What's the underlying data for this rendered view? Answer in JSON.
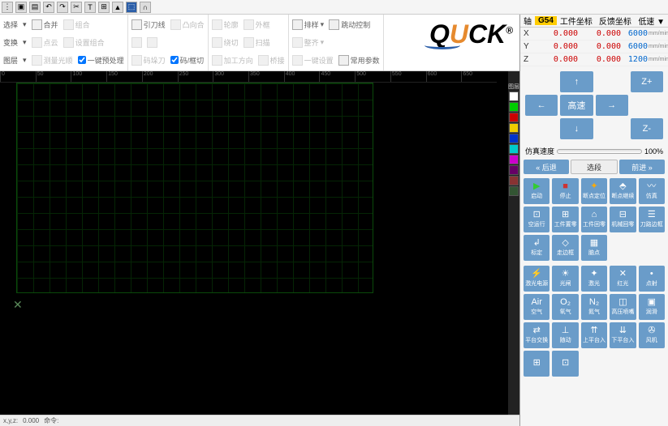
{
  "topbar": {
    "label": "⋮"
  },
  "ribbon": {
    "g1_label": "选择",
    "g1_items": [
      [
        "合并",
        "组合"
      ],
      [
        "点云",
        "设置组合"
      ],
      [
        "测量光顺",
        "一键预处理"
      ]
    ],
    "g1_row3_label": "变换",
    "g1_row4_label": "图层",
    "g2_items": [
      [
        "引刀线",
        "凸向合"
      ],
      [
        " ",
        " "
      ],
      [
        "码垛刀",
        "码/框切"
      ]
    ],
    "g3_items": [
      [
        "轮廓",
        "外框"
      ],
      [
        "绕切",
        "扫描"
      ],
      [
        "加工方向",
        "桥接"
      ]
    ],
    "g4_items": [
      [
        "排样",
        "跳动控制"
      ],
      [
        "整齐",
        " "
      ],
      [
        "一键设置",
        "常用参数"
      ]
    ]
  },
  "logo": {
    "text_q": "Q",
    "text_u": "U",
    "text_ck": "CK",
    "reg": "®"
  },
  "ruler_ticks": [
    "0",
    "50",
    "100",
    "150",
    "200",
    "250",
    "300",
    "350",
    "400",
    "450",
    "500",
    "550",
    "600",
    "650"
  ],
  "layer_colors": [
    "#ffffff",
    "#00cc00",
    "#cc0000",
    "#eecc00",
    "#0033cc",
    "#00cccc",
    "#cc00cc",
    "#660066",
    "#883333",
    "#335533"
  ],
  "layer_top_label": "图层",
  "statusbar": [
    "x,y,z:",
    "0.000",
    "命令:"
  ],
  "rpanel": {
    "head": {
      "axis_label": "轴",
      "g54": "G54",
      "wcs": "工件坐标",
      "mcs": "反馈坐标",
      "speed": "低速 ▼"
    },
    "rows": [
      {
        "axis": "X",
        "v1": "0.000",
        "v2": "0.000",
        "spd": "6000",
        "unit": "mm/min"
      },
      {
        "axis": "Y",
        "v1": "0.000",
        "v2": "0.000",
        "spd": "6000",
        "unit": "mm/min"
      },
      {
        "axis": "Z",
        "v1": "0.000",
        "v2": "0.000",
        "spd": "1200",
        "unit": "mm/min"
      }
    ],
    "jog": {
      "up": "↑",
      "down": "↓",
      "left": "←",
      "right": "→",
      "center": "高速",
      "zplus": "Z+",
      "zminus": "Z-"
    },
    "sim": {
      "label": "仿真速度",
      "value": "100%"
    },
    "step": {
      "back": "« 后退",
      "pick": "选段",
      "fwd": "前进 »"
    },
    "ctrl1": [
      {
        "icon": "▶",
        "label": "启动",
        "cls": "green"
      },
      {
        "icon": "■",
        "label": "停止",
        "cls": "red"
      },
      {
        "icon": "✦",
        "label": "断点定位",
        "cls": "orange"
      },
      {
        "icon": "⬘",
        "label": "断点继续"
      },
      {
        "icon": "〰",
        "label": "仿真"
      },
      {
        "icon": "⊡",
        "label": "空运行"
      },
      {
        "icon": "⊞",
        "label": "工件置零"
      },
      {
        "icon": "⌂",
        "label": "工件回零"
      },
      {
        "icon": "⊟",
        "label": "机械回零"
      },
      {
        "icon": "☰",
        "label": "刀路边框"
      },
      {
        "icon": "↲",
        "label": "标定"
      },
      {
        "icon": "◇",
        "label": "走边框"
      },
      {
        "icon": "▦",
        "label": "脑点"
      }
    ],
    "ctrl2": [
      {
        "icon": "⚡",
        "label": "激光电源"
      },
      {
        "icon": "☀",
        "label": "光闸"
      },
      {
        "icon": "✦",
        "label": "激光"
      },
      {
        "icon": "✕",
        "label": "红光"
      },
      {
        "icon": "•",
        "label": "点射"
      },
      {
        "icon": "Air",
        "label": "空气"
      },
      {
        "icon": "O₂",
        "label": "氧气"
      },
      {
        "icon": "N₂",
        "label": "氮气"
      },
      {
        "icon": "◫",
        "label": "高压喷嘴"
      },
      {
        "icon": "▣",
        "label": "润滑"
      },
      {
        "icon": "⇄",
        "label": "平台交换"
      },
      {
        "icon": "⊥",
        "label": "随动"
      },
      {
        "icon": "⇈",
        "label": "上平台入"
      },
      {
        "icon": "⇊",
        "label": "下平台入"
      },
      {
        "icon": "✇",
        "label": "风机"
      },
      {
        "icon": "⊞",
        "label": ""
      },
      {
        "icon": "⊡",
        "label": ""
      }
    ]
  }
}
